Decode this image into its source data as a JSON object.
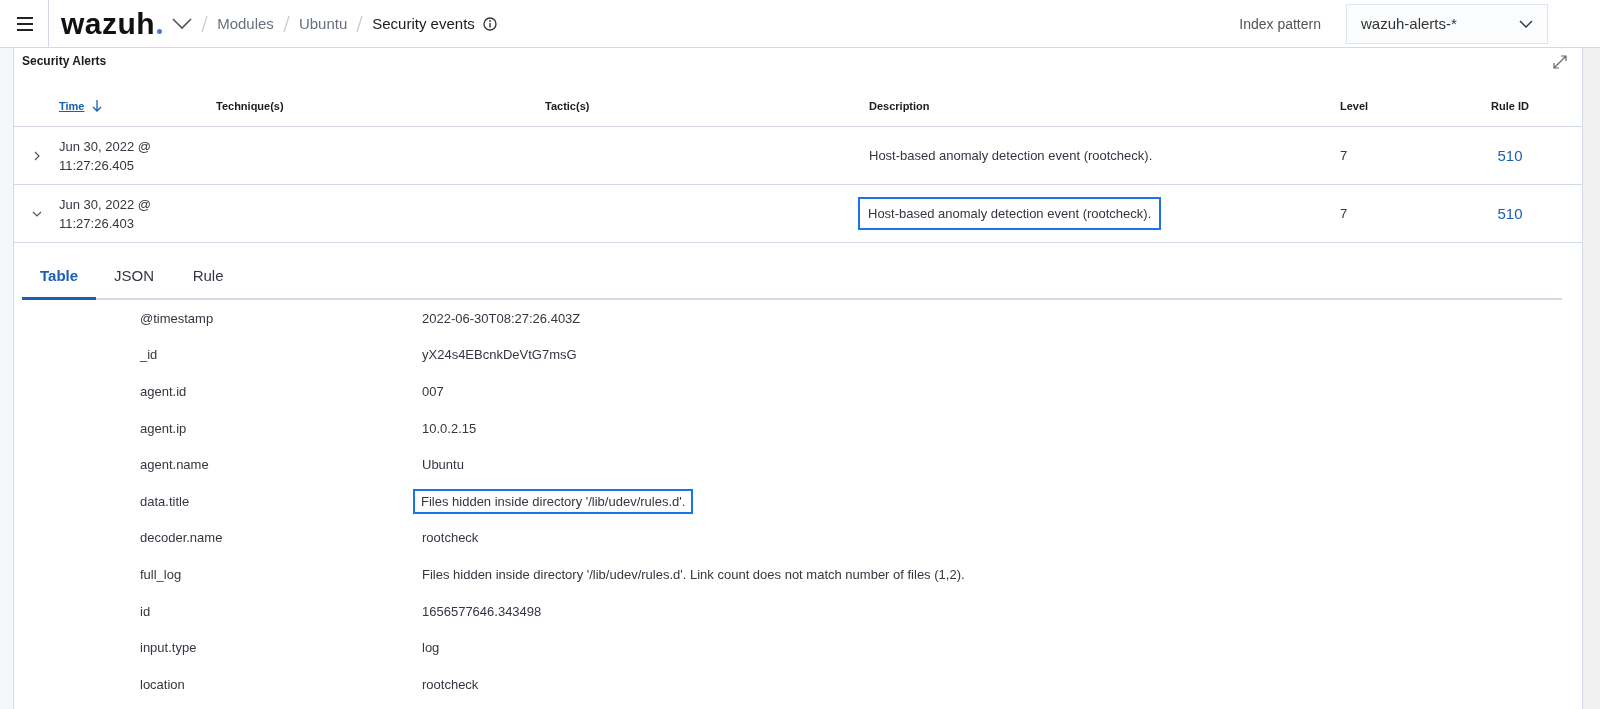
{
  "header": {
    "logo": "wazuh",
    "breadcrumbs": [
      {
        "label": "Modules",
        "current": false
      },
      {
        "label": "Ubuntu",
        "current": false
      },
      {
        "label": "Security events",
        "current": true
      }
    ],
    "index_pattern": {
      "label": "Index pattern",
      "value": "wazuh-alerts-*"
    }
  },
  "panel": {
    "title": "Security Alerts",
    "columns": [
      {
        "label": "Time",
        "sortable": true
      },
      {
        "label": "Technique(s)",
        "sortable": false
      },
      {
        "label": "Tactic(s)",
        "sortable": false
      },
      {
        "label": "Description",
        "sortable": false
      },
      {
        "label": "Level",
        "sortable": false
      },
      {
        "label": "Rule ID",
        "sortable": false
      }
    ],
    "rows": [
      {
        "expanded": false,
        "time": "Jun 30, 2022 @\n11:27:26.405",
        "technique": "",
        "tactic": "",
        "description": "Host-based anomaly detection event (rootcheck).",
        "description_highlighted": false,
        "level": "7",
        "rule_id": "510"
      },
      {
        "expanded": true,
        "time": "Jun 30, 2022 @\n11:27:26.403",
        "technique": "",
        "tactic": "",
        "description": "Host-based anomaly detection event (rootcheck).",
        "description_highlighted": true,
        "level": "7",
        "rule_id": "510"
      }
    ],
    "detail": {
      "tabs": [
        {
          "label": "Table",
          "selected": true
        },
        {
          "label": "JSON",
          "selected": false
        },
        {
          "label": "Rule",
          "selected": false
        }
      ],
      "fields": [
        {
          "key": "@timestamp",
          "value": "2022-06-30T08:27:26.403Z",
          "highlighted": false
        },
        {
          "key": "_id",
          "value": "yX24s4EBcnkDeVtG7msG",
          "highlighted": false
        },
        {
          "key": "agent.id",
          "value": "007",
          "highlighted": false
        },
        {
          "key": "agent.ip",
          "value": "10.0.2.15",
          "highlighted": false
        },
        {
          "key": "agent.name",
          "value": "Ubuntu",
          "highlighted": false
        },
        {
          "key": "data.title",
          "value": "Files hidden inside directory '/lib/udev/rules.d'.",
          "highlighted": true
        },
        {
          "key": "decoder.name",
          "value": "rootcheck",
          "highlighted": false
        },
        {
          "key": "full_log",
          "value": "Files hidden inside directory '/lib/udev/rules.d'. Link count does not match number of files (1,2).",
          "highlighted": false
        },
        {
          "key": "id",
          "value": "1656577646.343498",
          "highlighted": false
        },
        {
          "key": "input.type",
          "value": "log",
          "highlighted": false
        },
        {
          "key": "location",
          "value": "rootcheck",
          "highlighted": false
        }
      ]
    }
  }
}
